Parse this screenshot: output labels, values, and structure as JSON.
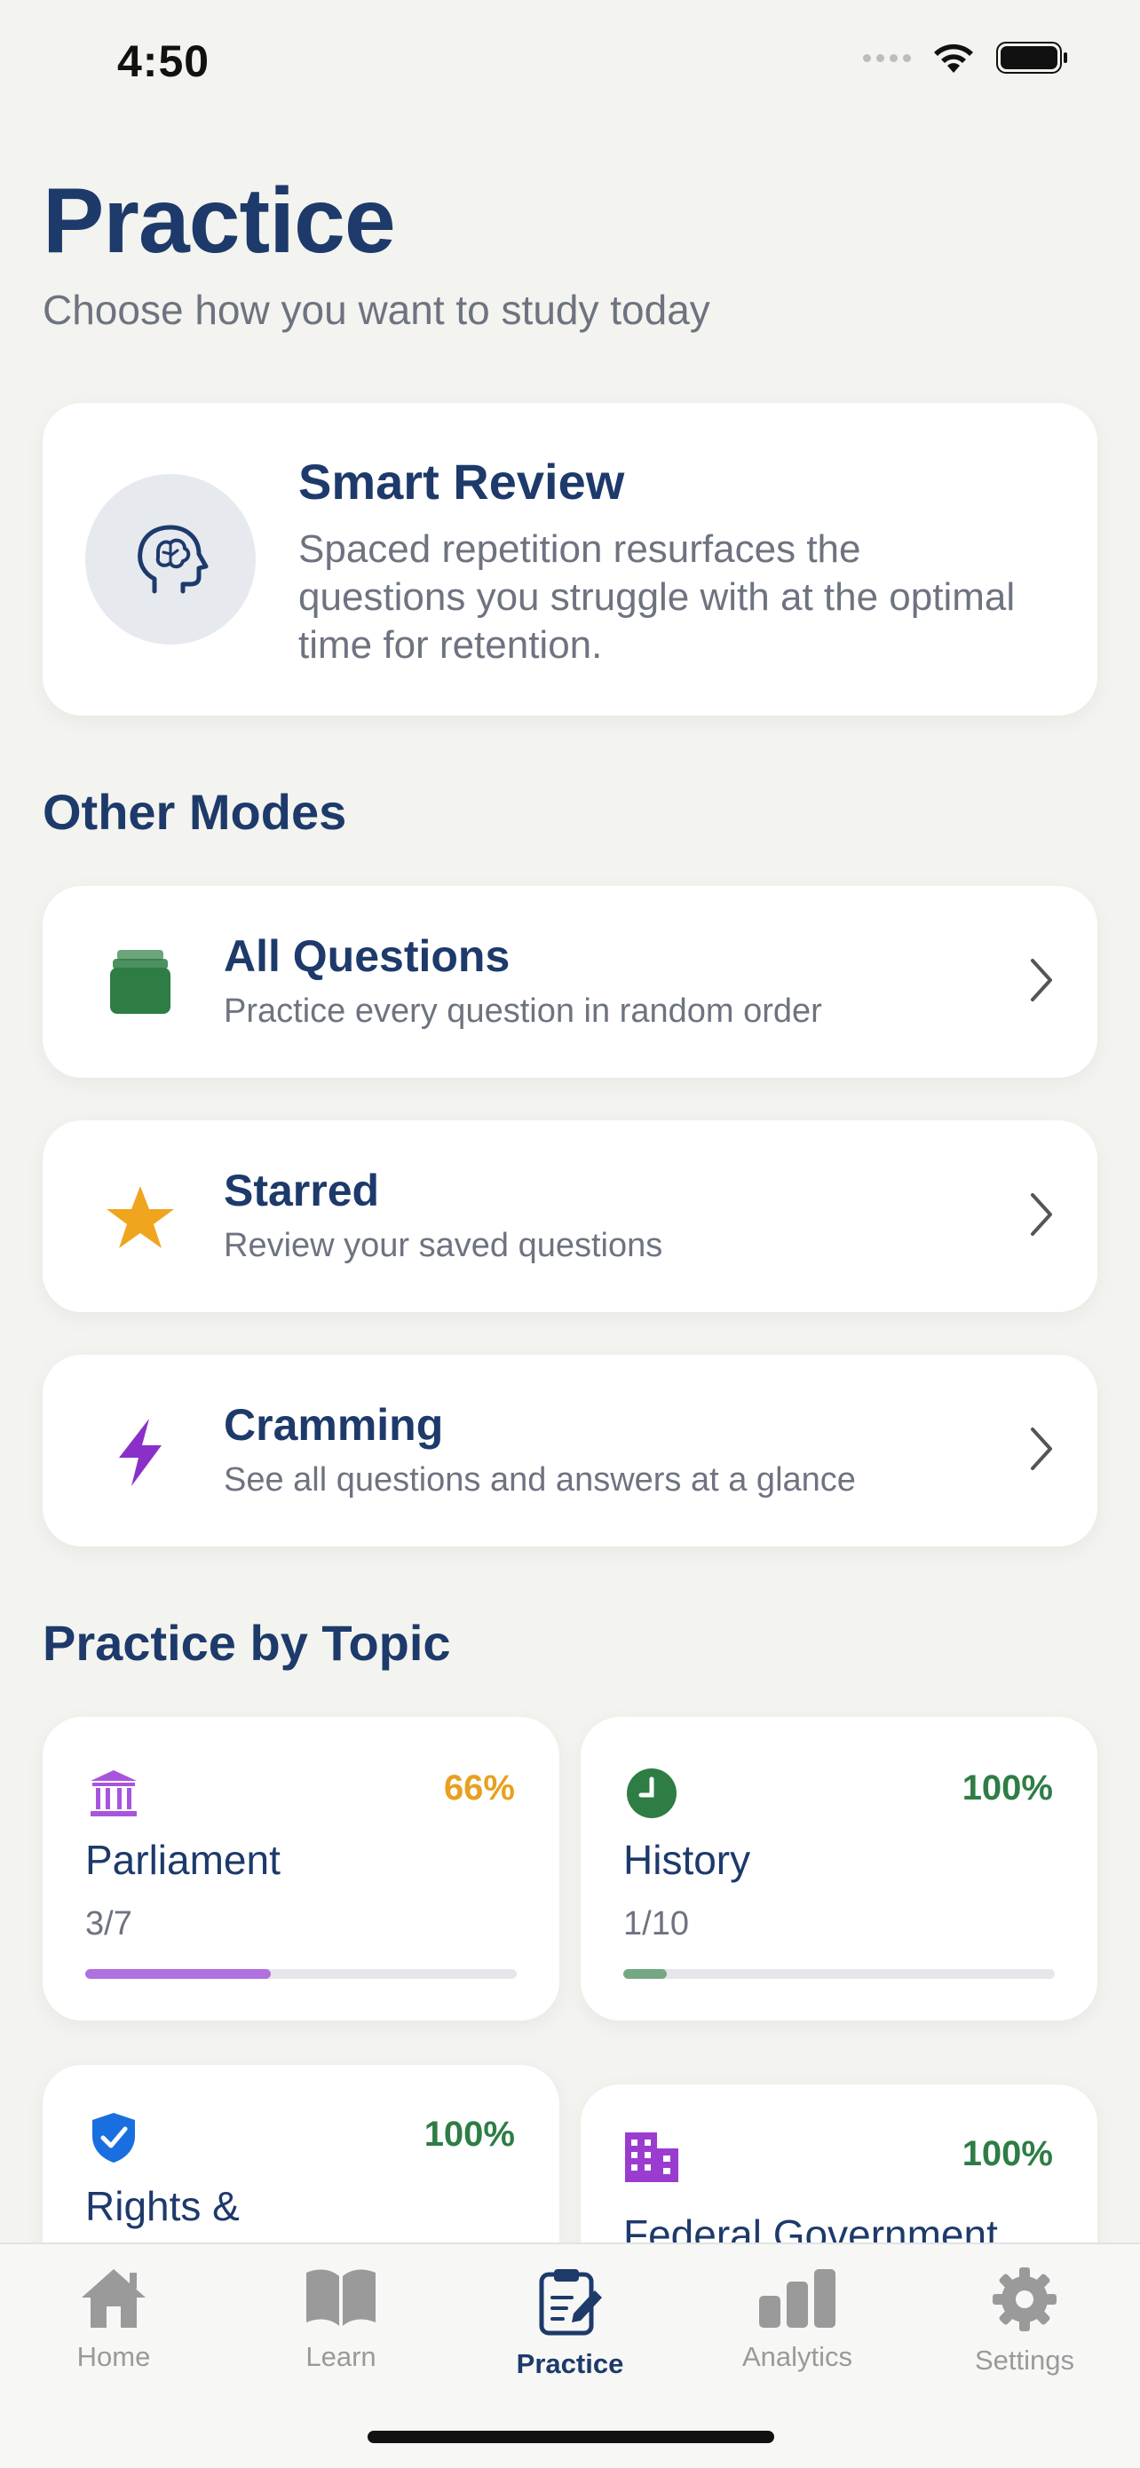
{
  "status_bar": {
    "time": "4:50"
  },
  "header": {
    "title": "Practice",
    "subtitle": "Choose how you want to study today"
  },
  "smart_review": {
    "title": "Smart Review",
    "description": "Spaced repetition resurfaces the questions you struggle with at the optimal time for retention.",
    "icon": "brain-head-icon"
  },
  "other_modes": {
    "heading": "Other Modes",
    "items": [
      {
        "title": "All Questions",
        "subtitle": "Practice every question in random order",
        "icon": "stack-icon",
        "color": "#2e7d45"
      },
      {
        "title": "Starred",
        "subtitle": "Review your saved questions",
        "icon": "star-icon",
        "color": "#f0a51f"
      },
      {
        "title": "Cramming",
        "subtitle": "See all questions and answers at a glance",
        "icon": "bolt-icon",
        "color": "#8b2fc9"
      }
    ]
  },
  "topics": {
    "heading": "Practice by Topic",
    "items": [
      {
        "name": "Parliament",
        "percent": "66%",
        "count": "3/7",
        "progress": 0.43,
        "icon": "parliament-icon",
        "color": "#a855dd",
        "percent_color": "#e8a020"
      },
      {
        "name": "History",
        "percent": "100%",
        "count": "1/10",
        "progress": 0.1,
        "icon": "clock-icon",
        "color": "#2e7d45",
        "percent_color": "#2e7d45"
      },
      {
        "name": "Rights &",
        "percent": "100%",
        "icon": "shield-check-icon",
        "color": "#1a6fe0",
        "percent_color": "#2e7d45"
      },
      {
        "name": "Federal Government",
        "percent": "100%",
        "icon": "building-icon",
        "color": "#9a3ccf",
        "percent_color": "#2e7d45"
      }
    ]
  },
  "tab_bar": {
    "items": [
      {
        "label": "Home",
        "icon": "house-icon"
      },
      {
        "label": "Learn",
        "icon": "book-icon"
      },
      {
        "label": "Practice",
        "icon": "clipboard-pencil-icon",
        "active": true
      },
      {
        "label": "Analytics",
        "icon": "bar-chart-icon"
      },
      {
        "label": "Settings",
        "icon": "gear-icon"
      }
    ]
  }
}
